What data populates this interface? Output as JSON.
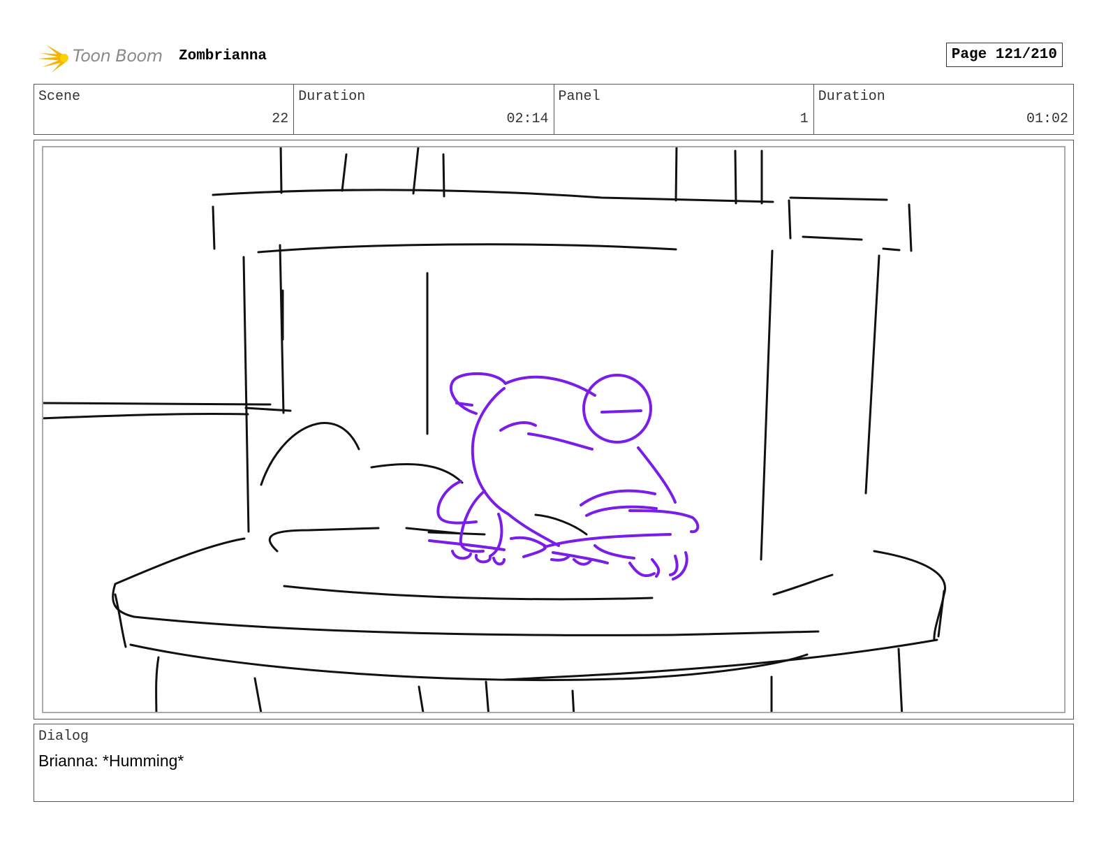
{
  "header": {
    "logo_text": "Toon Boom",
    "project_title": "Zombrianna",
    "page_label": "Page 121/210"
  },
  "info": {
    "scene_label": "Scene",
    "scene_value": "22",
    "scene_duration_label": "Duration",
    "scene_duration_value": "02:14",
    "panel_label": "Panel",
    "panel_value": "1",
    "panel_duration_label": "Duration",
    "panel_duration_value": "01:02"
  },
  "dialog": {
    "label": "Dialog",
    "text": "Brianna: *Humming*"
  },
  "colors": {
    "sketch_ink": "#111111",
    "character_ink": "#7a1de8",
    "logo_accent": "#f5b400"
  }
}
